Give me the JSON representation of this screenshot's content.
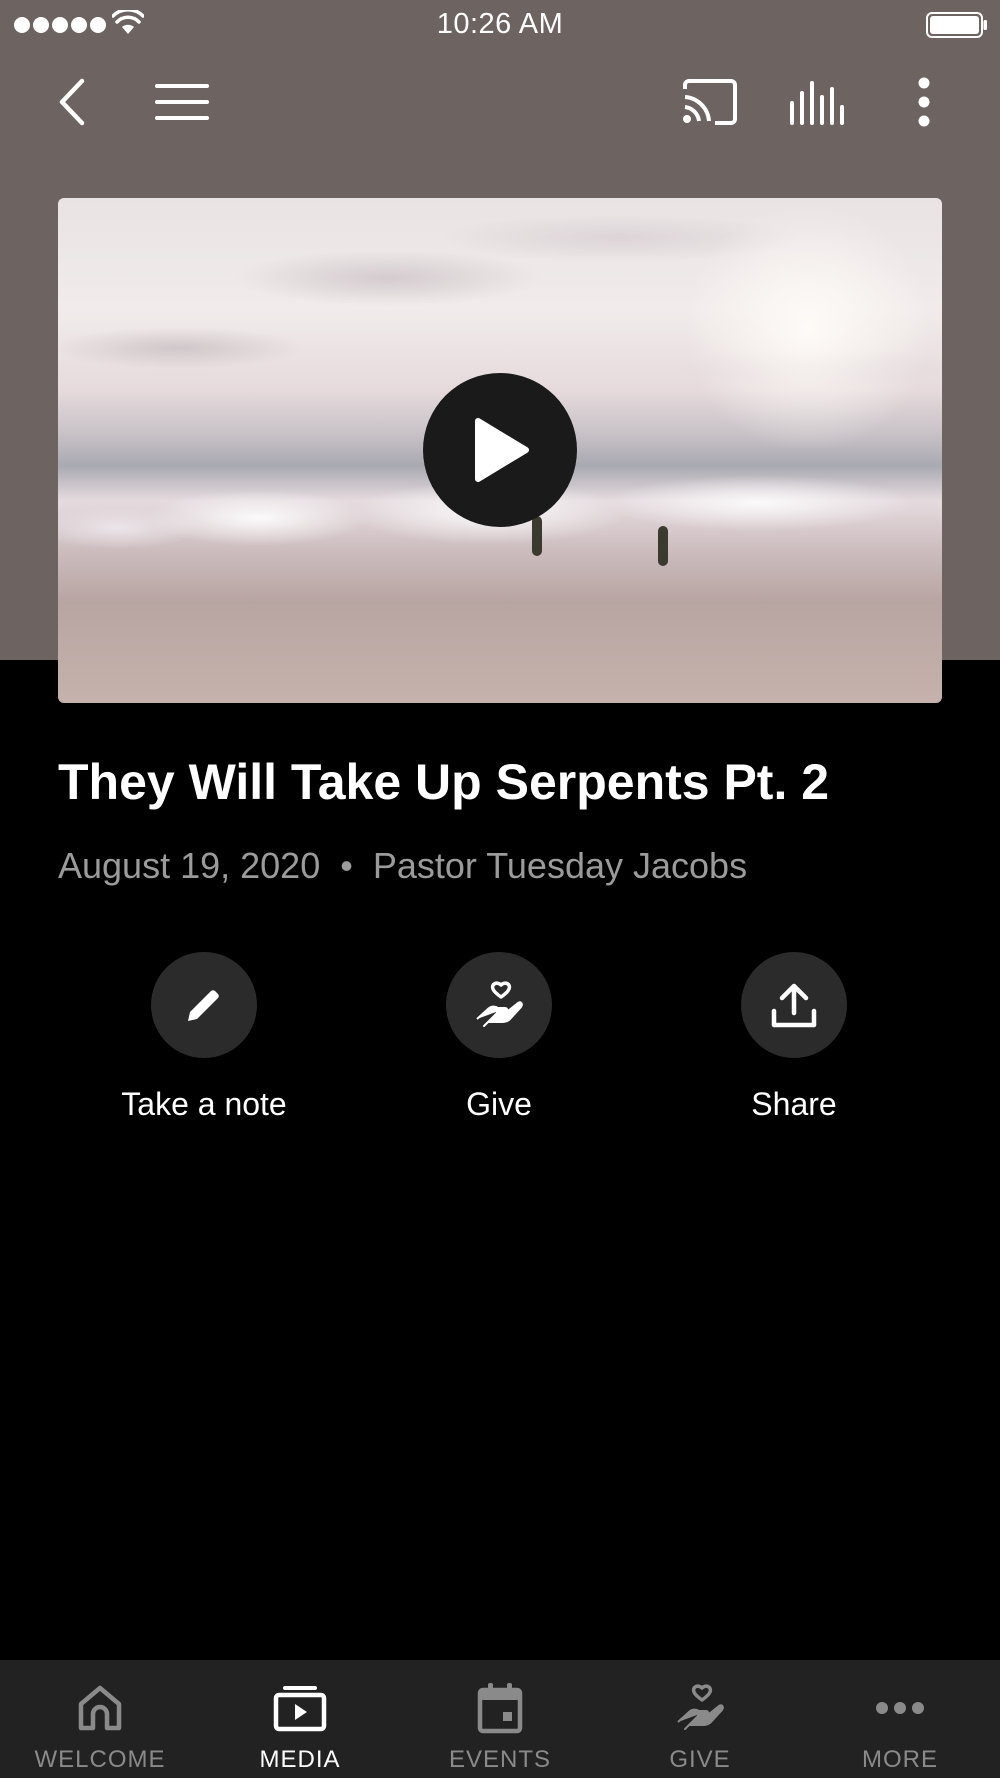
{
  "status_bar": {
    "time": "10:26 AM"
  },
  "toolbar": {
    "icons": [
      "back-icon",
      "menu-icon",
      "cast-icon",
      "audio-bars-icon",
      "more-vertical-icon"
    ]
  },
  "media": {
    "title": "They Will Take Up Serpents Pt. 2",
    "date": "August 19, 2020",
    "separator": "•",
    "speaker": "Pastor Tuesday Jacobs"
  },
  "actions": [
    {
      "label": "Take a note",
      "icon": "pencil-icon"
    },
    {
      "label": "Give",
      "icon": "heart-hand-icon"
    },
    {
      "label": "Share",
      "icon": "upload-icon"
    }
  ],
  "tabs": [
    {
      "label": "WELCOME",
      "icon": "home-icon",
      "active": false
    },
    {
      "label": "MEDIA",
      "icon": "media-icon",
      "active": true
    },
    {
      "label": "EVENTS",
      "icon": "calendar-icon",
      "active": false
    },
    {
      "label": "GIVE",
      "icon": "heart-hand-icon",
      "active": false
    },
    {
      "label": "MORE",
      "icon": "more-horizontal-icon",
      "active": false
    }
  ],
  "colors": {
    "header_bg": "#6d6361",
    "page_bg": "#000000",
    "tabbar_bg": "#222222",
    "action_circle": "#2b2b2b",
    "muted_text": "#9b9b9b",
    "inactive_tab": "#8a8a8a"
  }
}
